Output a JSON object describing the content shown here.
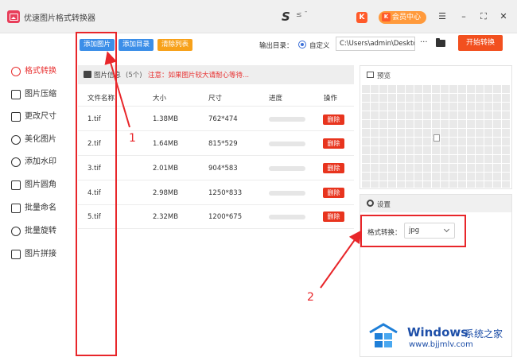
{
  "app": {
    "title": "优速图片格式转换器"
  },
  "titlebar": {
    "s_mark": "S",
    "misc_text": "≤ ¯",
    "k_badge": "K",
    "vip_label": "会员中心",
    "vip_k": "K",
    "menu_glyph": "☰",
    "min_glyph": "–",
    "max_glyph": "⛶",
    "close_glyph": "✕"
  },
  "toolbar": {
    "add_image": "添加图片",
    "add_folder": "添加目录",
    "clear_list": "清除列表",
    "output_label": "输出目录：",
    "custom_label": "自定义",
    "output_path": "C:\\Users\\admin\\Deskto",
    "more": "···",
    "start": "开始转换"
  },
  "sidebar": {
    "items": [
      {
        "label": "格式转换",
        "active": true
      },
      {
        "label": "图片压缩"
      },
      {
        "label": "更改尺寸"
      },
      {
        "label": "美化图片"
      },
      {
        "label": "添加水印"
      },
      {
        "label": "图片圆角"
      },
      {
        "label": "批量命名"
      },
      {
        "label": "批量旋转"
      },
      {
        "label": "图片拼接"
      }
    ]
  },
  "file_list": {
    "title": "图片信息",
    "count": "(5个)",
    "note": "注意：如果图片较大请耐心等待...",
    "columns": [
      "文件名称",
      "大小",
      "尺寸",
      "进度",
      "操作"
    ],
    "rows": [
      {
        "name": "1.tif",
        "size": "1.38MB",
        "dim": "762*474",
        "delete": "删除"
      },
      {
        "name": "2.tif",
        "size": "1.64MB",
        "dim": "815*529",
        "delete": "删除"
      },
      {
        "name": "3.tif",
        "size": "2.01MB",
        "dim": "904*583",
        "delete": "删除"
      },
      {
        "name": "4.tif",
        "size": "2.98MB",
        "dim": "1250*833",
        "delete": "删除"
      },
      {
        "name": "5.tif",
        "size": "2.32MB",
        "dim": "1200*675",
        "delete": "删除"
      }
    ]
  },
  "preview": {
    "title": "预览"
  },
  "settings": {
    "title": "设置",
    "format_label": "格式转换：",
    "format_value": "jpg"
  },
  "annotations": {
    "one": "1",
    "two": "2",
    "color": "#e8262a"
  },
  "watermark": {
    "title": "Windows",
    "title_cn": "系统之家",
    "url": "www.bjjmlv.com"
  },
  "colors": {
    "accent_blue": "#3b8ee8",
    "start_orange": "#f2501f",
    "delete_red": "#e8341e",
    "clear_orange": "#f7a11a"
  }
}
